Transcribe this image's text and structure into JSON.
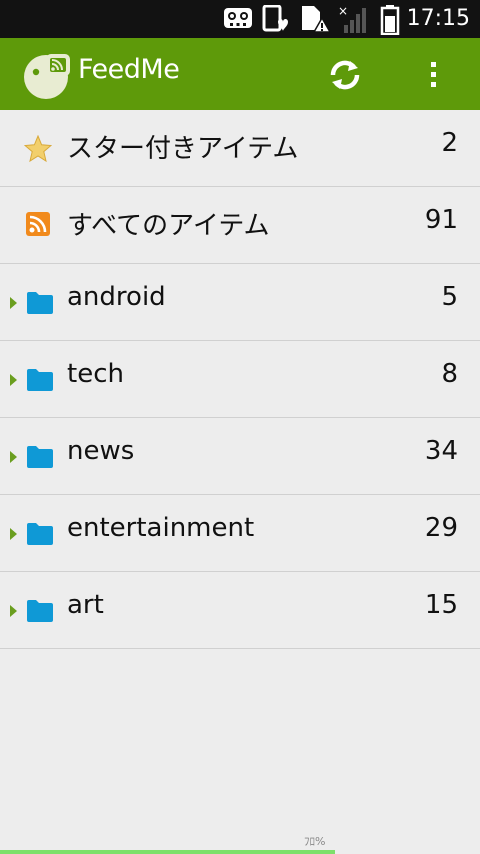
{
  "status_bar": {
    "time": "17:15",
    "icons": [
      "voicemail-icon",
      "phone-heart-icon",
      "sd-card-warning-icon",
      "signal-no-service-icon",
      "battery-icon"
    ]
  },
  "app_bar": {
    "title": "FeedMe",
    "logo_icon": "feedme-logo-icon",
    "refresh_icon": "refresh-icon",
    "overflow_icon": "overflow-menu-icon",
    "accent_color": "#5e9a0a"
  },
  "feeds": {
    "items": [
      {
        "icon": "star-icon",
        "label": "スター付きアイテム",
        "count": "2"
      },
      {
        "icon": "rss-icon",
        "label": "すべてのアイテム",
        "count": "91"
      },
      {
        "icon": "folder-icon",
        "label": "android",
        "count": "5"
      },
      {
        "icon": "folder-icon",
        "label": "tech",
        "count": "8"
      },
      {
        "icon": "folder-icon",
        "label": "news",
        "count": "34"
      },
      {
        "icon": "folder-icon",
        "label": "entertainment",
        "count": "29"
      },
      {
        "icon": "folder-icon",
        "label": "art",
        "count": "15"
      }
    ]
  },
  "footer": {
    "progress_label": "ﾌﾛ%"
  }
}
